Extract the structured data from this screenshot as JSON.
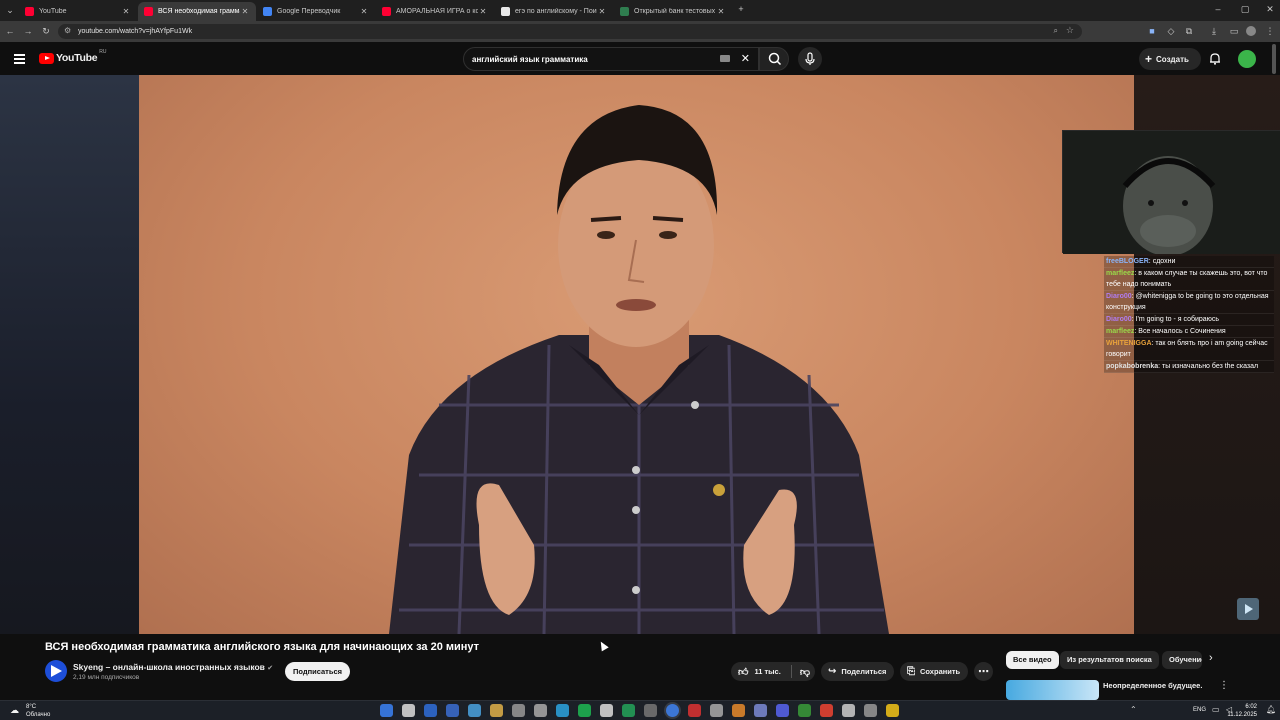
{
  "browser": {
    "tabs": [
      {
        "label": "YouTube",
        "favicon": "youtube-favicon",
        "active": false
      },
      {
        "label": "ВСЯ необходимая грамматика",
        "favicon": "youtube-favicon",
        "active": true
      },
      {
        "label": "Google Переводчик",
        "favicon": "google-translate-favicon",
        "active": false
      },
      {
        "label": "АМОРАЛЬНАЯ ИГРА о котор",
        "favicon": "youtube-favicon",
        "active": false
      },
      {
        "label": "егэ по английскому - Поиск в",
        "favicon": "google-favicon",
        "active": false
      },
      {
        "label": "Открытый банк тестовых зада",
        "favicon": "fipi-favicon",
        "active": false
      }
    ],
    "url": "youtube.com/watch?v=jhAYfpFu1Wk"
  },
  "youtube": {
    "logo_text": "YouTube",
    "region": "RU",
    "search_value": "английский язык грамматика",
    "create_label": "Создать"
  },
  "chat": [
    {
      "user": "freeBLOGER",
      "color": "#8ab4f8",
      "text": "сдохни"
    },
    {
      "user": "marfleez",
      "color": "#9ad94a",
      "text": "в каком случае ты скажешь это, вот что тебе надо понимать"
    },
    {
      "user": "Diaro00",
      "color": "#b07cf0",
      "text": "@whitenigga to be going to это отдельная конструкция"
    },
    {
      "user": "Diaro00",
      "color": "#b07cf0",
      "text": "I'm going to - я собираюсь"
    },
    {
      "user": "marfleez",
      "color": "#9ad94a",
      "text": "Все началось с Сочинения"
    },
    {
      "user": "WHITENIGGA",
      "color": "#e9a23b",
      "text": "так он блять про i am going сейчас говорит"
    },
    {
      "user": "popkabobrenka",
      "color": "#e0e0e0",
      "text": "ты изначально без the сказал"
    }
  ],
  "video": {
    "title": "ВСЯ необходимая грамматика английского языка для начинающих за 20 минут",
    "channel": "Skyeng – онлайн-школа иностранных языков",
    "subscribers": "2,19 млн подписчиков",
    "subscribe_label": "Подписаться",
    "likes": "11 тыс.",
    "share_label": "Поделиться",
    "save_label": "Сохранить"
  },
  "filter_chips": [
    "Все видео",
    "Из результатов поиска",
    "Обучение"
  ],
  "taskbar": {
    "weather_temp": "8°C",
    "weather_text": "Облачно",
    "language": "ENG",
    "time": "6:02",
    "date": "11.12.2025"
  }
}
